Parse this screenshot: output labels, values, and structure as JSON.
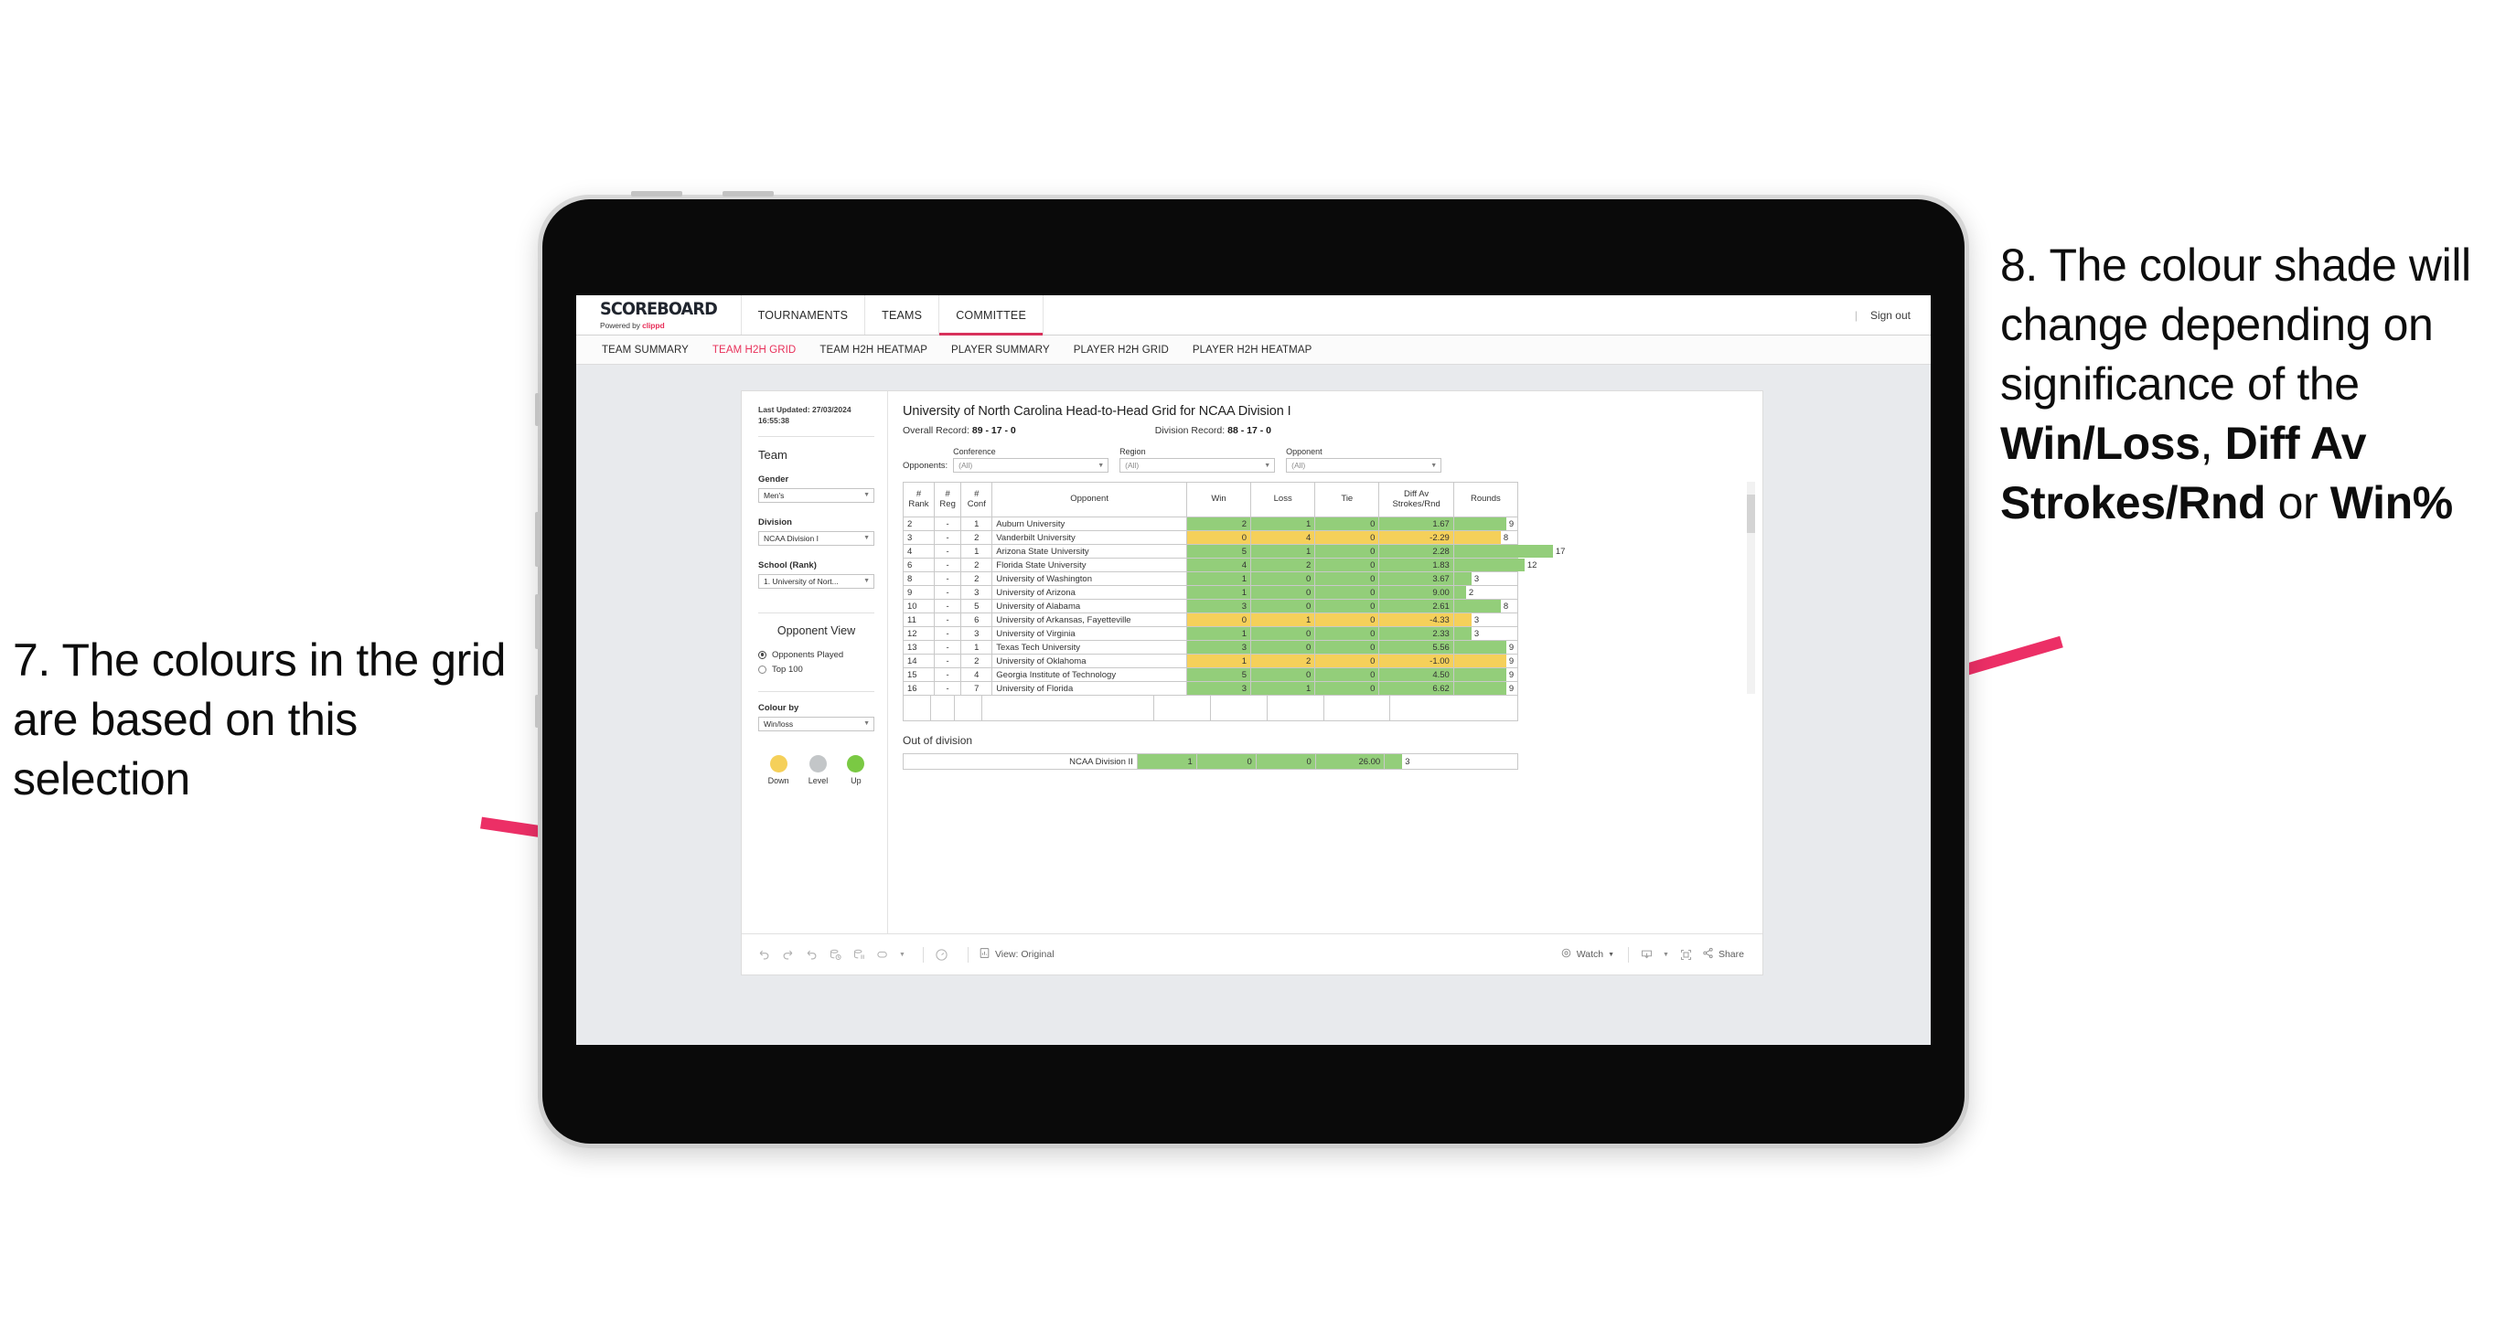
{
  "annotations": {
    "left": {
      "number": "7.",
      "text": "7. The colours in the grid are based on this selection"
    },
    "right": {
      "lead": "8. The colour shade will change depending on significance of the ",
      "bold1": "Win/Loss",
      "mid1": ", ",
      "bold2": "Diff Av Strokes/Rnd",
      "mid2": " or ",
      "bold3": "Win%"
    }
  },
  "app": {
    "brand": {
      "title": "SCOREBOARD",
      "powered_prefix": "Powered by ",
      "powered_accent": "clippd"
    },
    "nav": [
      {
        "label": "TOURNAMENTS",
        "active": false
      },
      {
        "label": "TEAMS",
        "active": false
      },
      {
        "label": "COMMITTEE",
        "active": true
      }
    ],
    "signout": {
      "separator": "|",
      "label": "Sign out"
    },
    "subnav": [
      {
        "label": "TEAM SUMMARY",
        "active": false
      },
      {
        "label": "TEAM H2H GRID",
        "active": true
      },
      {
        "label": "TEAM H2H HEATMAP",
        "active": false
      },
      {
        "label": "PLAYER SUMMARY",
        "active": false
      },
      {
        "label": "PLAYER H2H GRID",
        "active": false
      },
      {
        "label": "PLAYER H2H HEATMAP",
        "active": false
      }
    ]
  },
  "sidebar": {
    "last_updated": "Last Updated: 27/03/2024 16:55:38",
    "team_heading": "Team",
    "gender": {
      "label": "Gender",
      "value": "Men's"
    },
    "division": {
      "label": "Division",
      "value": "NCAA Division I"
    },
    "school": {
      "label": "School (Rank)",
      "value": "1. University of Nort..."
    },
    "opponent_view": {
      "heading": "Opponent View",
      "options": [
        {
          "label": "Opponents Played",
          "selected": true
        },
        {
          "label": "Top 100",
          "selected": false
        }
      ]
    },
    "colour_by": {
      "label": "Colour by",
      "value": "Win/loss"
    },
    "legend": [
      {
        "label": "Down",
        "color": "#f5d05a"
      },
      {
        "label": "Level",
        "color": "#c3c6c8"
      },
      {
        "label": "Up",
        "color": "#7ac943"
      }
    ]
  },
  "main": {
    "title": "University of North Carolina Head-to-Head Grid for NCAA Division I",
    "overall_record_label": "Overall Record: ",
    "overall_record_value": "89 - 17 - 0",
    "division_record_label": "Division Record: ",
    "division_record_value": "88 - 17 - 0",
    "opponents_label": "Opponents:",
    "filters": [
      {
        "label": "Conference",
        "value": "(All)"
      },
      {
        "label": "Region",
        "value": "(All)"
      },
      {
        "label": "Opponent",
        "value": "(All)"
      }
    ]
  },
  "chart_data": {
    "type": "table",
    "title": "University of North Carolina Head-to-Head Grid for NCAA Division I",
    "columns": [
      "# Rank",
      "# Reg",
      "# Conf",
      "Opponent",
      "Win",
      "Loss",
      "Tie",
      "Diff Av Strokes/Rnd",
      "Rounds"
    ],
    "column_headers_wrapped": [
      [
        "#",
        "Rank"
      ],
      [
        "#",
        "Reg"
      ],
      [
        "#",
        "Conf"
      ],
      [
        "Opponent"
      ],
      [
        "Win"
      ],
      [
        "Loss"
      ],
      [
        "Tie"
      ],
      [
        "Diff Av",
        "Strokes/Rnd"
      ],
      [
        "Rounds"
      ]
    ],
    "rounds_max": 17,
    "rows": [
      {
        "rank": "2",
        "reg": "-",
        "conf": "1",
        "opponent": "Auburn University",
        "win": "2",
        "loss": "1",
        "tie": "0",
        "diff": "1.67",
        "rounds": 9,
        "result": "win"
      },
      {
        "rank": "3",
        "reg": "-",
        "conf": "2",
        "opponent": "Vanderbilt University",
        "win": "0",
        "loss": "4",
        "tie": "0",
        "diff": "-2.29",
        "rounds": 8,
        "result": "loss"
      },
      {
        "rank": "4",
        "reg": "-",
        "conf": "1",
        "opponent": "Arizona State University",
        "win": "5",
        "loss": "1",
        "tie": "0",
        "diff": "2.28",
        "rounds": 17,
        "result": "win"
      },
      {
        "rank": "6",
        "reg": "-",
        "conf": "2",
        "opponent": "Florida State University",
        "win": "4",
        "loss": "2",
        "tie": "0",
        "diff": "1.83",
        "rounds": 12,
        "result": "win"
      },
      {
        "rank": "8",
        "reg": "-",
        "conf": "2",
        "opponent": "University of Washington",
        "win": "1",
        "loss": "0",
        "tie": "0",
        "diff": "3.67",
        "rounds": 3,
        "result": "win"
      },
      {
        "rank": "9",
        "reg": "-",
        "conf": "3",
        "opponent": "University of Arizona",
        "win": "1",
        "loss": "0",
        "tie": "0",
        "diff": "9.00",
        "rounds": 2,
        "result": "win"
      },
      {
        "rank": "10",
        "reg": "-",
        "conf": "5",
        "opponent": "University of Alabama",
        "win": "3",
        "loss": "0",
        "tie": "0",
        "diff": "2.61",
        "rounds": 8,
        "result": "win"
      },
      {
        "rank": "11",
        "reg": "-",
        "conf": "6",
        "opponent": "University of Arkansas, Fayetteville",
        "win": "0",
        "loss": "1",
        "tie": "0",
        "diff": "-4.33",
        "rounds": 3,
        "result": "loss"
      },
      {
        "rank": "12",
        "reg": "-",
        "conf": "3",
        "opponent": "University of Virginia",
        "win": "1",
        "loss": "0",
        "tie": "0",
        "diff": "2.33",
        "rounds": 3,
        "result": "win"
      },
      {
        "rank": "13",
        "reg": "-",
        "conf": "1",
        "opponent": "Texas Tech University",
        "win": "3",
        "loss": "0",
        "tie": "0",
        "diff": "5.56",
        "rounds": 9,
        "result": "win"
      },
      {
        "rank": "14",
        "reg": "-",
        "conf": "2",
        "opponent": "University of Oklahoma",
        "win": "1",
        "loss": "2",
        "tie": "0",
        "diff": "-1.00",
        "rounds": 9,
        "result": "loss"
      },
      {
        "rank": "15",
        "reg": "-",
        "conf": "4",
        "opponent": "Georgia Institute of Technology",
        "win": "5",
        "loss": "0",
        "tie": "0",
        "diff": "4.50",
        "rounds": 9,
        "result": "win"
      },
      {
        "rank": "16",
        "reg": "-",
        "conf": "7",
        "opponent": "University of Florida",
        "win": "3",
        "loss": "1",
        "tie": "0",
        "diff": "6.62",
        "rounds": 9,
        "result": "win"
      }
    ],
    "out_of_division": {
      "title": "Out of division",
      "rows": [
        {
          "label": "NCAA Division II",
          "win": "1",
          "loss": "0",
          "tie": "0",
          "diff": "26.00",
          "rounds": 3,
          "result": "win"
        }
      ]
    },
    "colors": {
      "win": "#93ce7a",
      "loss": "#f5d05a",
      "level": "#c3c6c8"
    }
  },
  "toolbar": {
    "view_label": "View: Original",
    "watch_label": "Watch",
    "share_label": "Share"
  }
}
